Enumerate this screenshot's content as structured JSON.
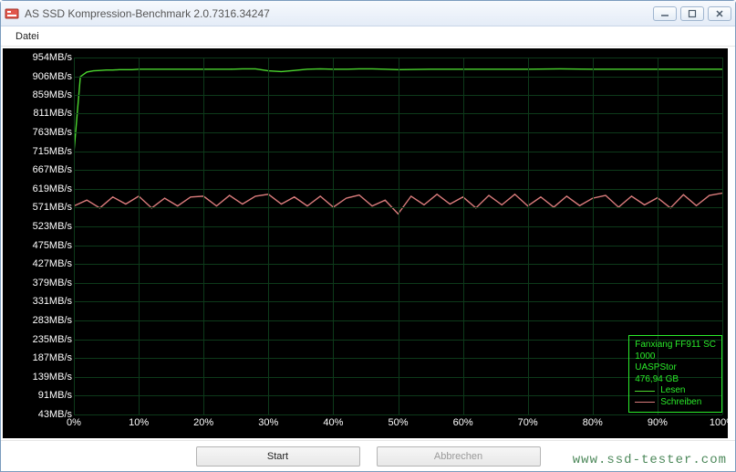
{
  "window": {
    "title": "AS SSD Kompression-Benchmark 2.0.7316.34247"
  },
  "menu": {
    "file": "Datei"
  },
  "buttons": {
    "start": "Start",
    "cancel": "Abbrechen"
  },
  "legend": {
    "device_line1": "Fanxiang FF911 SC",
    "device_line2": "1000",
    "driver": "UASPStor",
    "capacity": "476,94 GB",
    "read_label": "Lesen",
    "write_label": "Schreiben",
    "read_color": "#4cd92f",
    "write_color": "#d97b7b"
  },
  "watermark": "www.ssd-tester.com",
  "chart_data": {
    "type": "line",
    "xlabel": "",
    "ylabel": "",
    "x_unit": "%",
    "y_unit": "MB/s",
    "xlim": [
      0,
      100
    ],
    "ylim": [
      43,
      954
    ],
    "x_ticks": [
      0,
      10,
      20,
      30,
      40,
      50,
      60,
      70,
      80,
      90,
      100
    ],
    "y_ticks": [
      43,
      91,
      139,
      187,
      235,
      283,
      331,
      379,
      427,
      475,
      523,
      571,
      619,
      667,
      715,
      763,
      811,
      859,
      906,
      954
    ],
    "series": [
      {
        "name": "Lesen",
        "color": "#4cd92f",
        "x": [
          0,
          1,
          2,
          3,
          4,
          5,
          6,
          7,
          8,
          9,
          10,
          12,
          14,
          16,
          18,
          20,
          22,
          24,
          26,
          28,
          30,
          32,
          34,
          36,
          38,
          40,
          42,
          44,
          46,
          48,
          50,
          55,
          60,
          65,
          70,
          75,
          80,
          85,
          90,
          95,
          100
        ],
        "values": [
          710,
          905,
          917,
          920,
          921,
          922,
          922,
          923,
          923,
          923,
          924,
          924,
          924,
          924,
          924,
          924,
          924,
          924,
          925,
          925,
          920,
          918,
          921,
          924,
          925,
          924,
          924,
          925,
          925,
          924,
          923,
          924,
          924,
          924,
          924,
          925,
          924,
          924,
          924,
          924,
          924
        ]
      },
      {
        "name": "Schreiben",
        "color": "#d97b7b",
        "x": [
          0,
          2,
          4,
          6,
          8,
          10,
          12,
          14,
          16,
          18,
          20,
          22,
          24,
          26,
          28,
          30,
          32,
          34,
          36,
          38,
          40,
          42,
          44,
          46,
          48,
          50,
          52,
          54,
          56,
          58,
          60,
          62,
          64,
          66,
          68,
          70,
          72,
          74,
          76,
          78,
          80,
          82,
          84,
          86,
          88,
          90,
          92,
          94,
          96,
          98,
          100
        ],
        "values": [
          575,
          590,
          570,
          598,
          580,
          600,
          570,
          595,
          575,
          598,
          600,
          575,
          602,
          580,
          600,
          605,
          580,
          598,
          575,
          600,
          572,
          595,
          603,
          575,
          590,
          555,
          600,
          578,
          605,
          580,
          598,
          570,
          602,
          578,
          605,
          575,
          598,
          572,
          600,
          576,
          595,
          602,
          572,
          600,
          578,
          596,
          570,
          604,
          576,
          602,
          608
        ]
      }
    ]
  }
}
